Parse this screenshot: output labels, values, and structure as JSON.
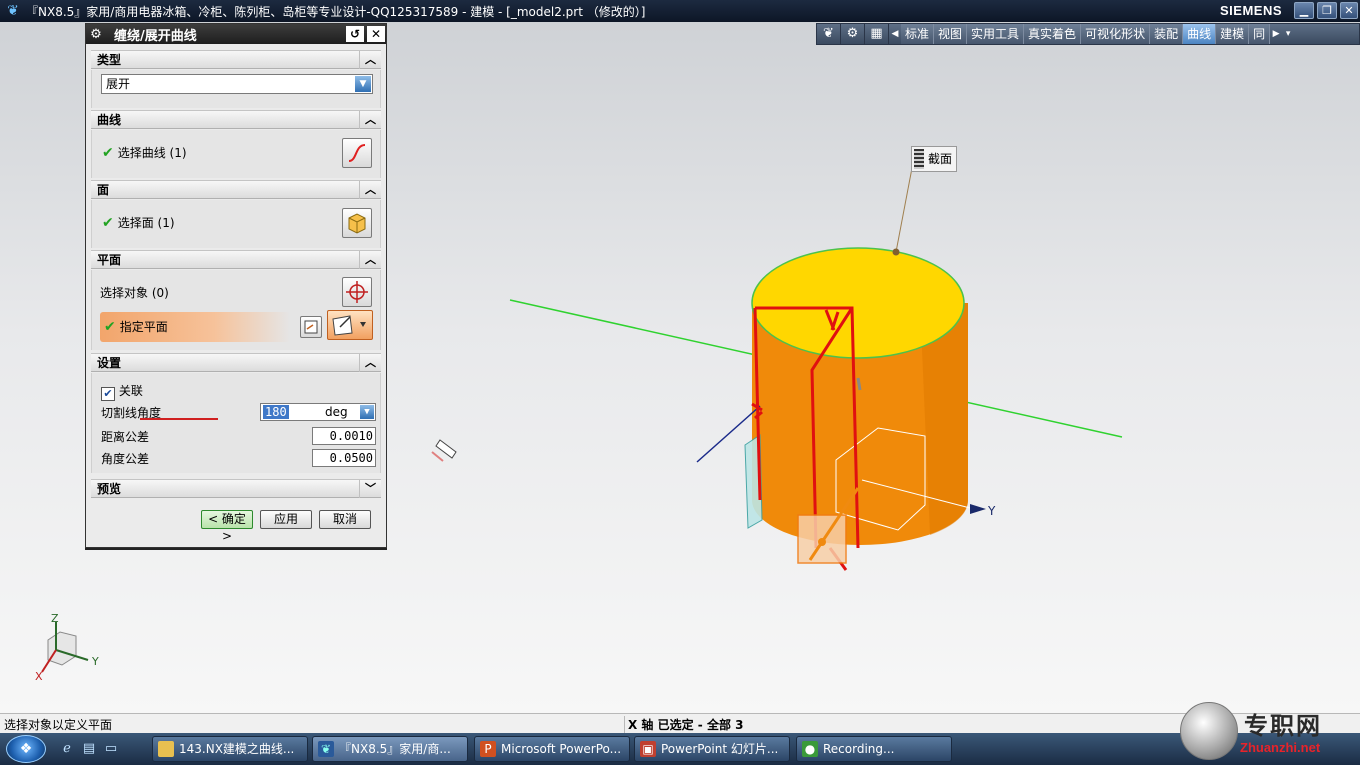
{
  "window": {
    "title": "『NX8.5』家用/商用电器冰箱、冷柜、陈列柜、岛柜等专业设计-QQ125317589 - 建模 - [_model2.prt （修改的）]",
    "brand": "SIEMENS",
    "controls": {
      "minimize": "▁",
      "restore": "❐",
      "close": "✕"
    }
  },
  "toolbar": {
    "tabs": [
      {
        "label": "标准",
        "active": false
      },
      {
        "label": "视图",
        "active": false
      },
      {
        "label": "实用工具",
        "active": false
      },
      {
        "label": "真实着色",
        "active": false
      },
      {
        "label": "可视化形状",
        "active": false
      },
      {
        "label": "装配",
        "active": false
      },
      {
        "label": "曲线",
        "active": true
      },
      {
        "label": "建模",
        "active": false
      },
      {
        "label": "同",
        "active": false
      }
    ]
  },
  "dialog": {
    "title": "缠绕/展开曲线",
    "groups": {
      "type": {
        "label": "类型",
        "selected": "展开"
      },
      "curve": {
        "label": "曲线",
        "select_label": "选择曲线 (1)"
      },
      "face": {
        "label": "面",
        "select_label": "选择面 (1)"
      },
      "plane": {
        "label": "平面",
        "select_object": "选择对象 (0)",
        "specify_plane": "指定平面"
      },
      "settings": {
        "label": "设置",
        "associative": "关联",
        "cut_angle_label": "切割线角度",
        "cut_angle_value": "180",
        "cut_angle_unit": "deg",
        "dist_tol_label": "距离公差",
        "dist_tol_value": "0.0010",
        "angle_tol_label": "角度公差",
        "angle_tol_value": "0.0500"
      },
      "preview": {
        "label": "预览"
      }
    },
    "buttons": {
      "ok": "< 确定 >",
      "apply": "应用",
      "cancel": "取消"
    }
  },
  "viewport": {
    "section_label": "截面",
    "axis_y_label": "Y",
    "triad": {
      "x": "X",
      "y": "Y",
      "z": "Z"
    }
  },
  "statusbar": {
    "left": "选择对象以定义平面",
    "right": "X 轴 已选定 - 全部 3"
  },
  "taskbar": {
    "items": [
      {
        "label": "143.NX建模之曲线..."
      },
      {
        "label": "『NX8.5』家用/商..."
      },
      {
        "label": "Microsoft PowerPo..."
      },
      {
        "label": "PowerPoint 幻灯片..."
      },
      {
        "label": "Recording..."
      }
    ]
  },
  "watermark": {
    "text_cn": "专职网",
    "text_en": "Zhuanzhi.net"
  },
  "colors": {
    "cylinder_top": "#ffd700",
    "cylinder_side": "#f08a0a",
    "toolbar_active": "#4b84c2",
    "check_green": "#22a322"
  }
}
